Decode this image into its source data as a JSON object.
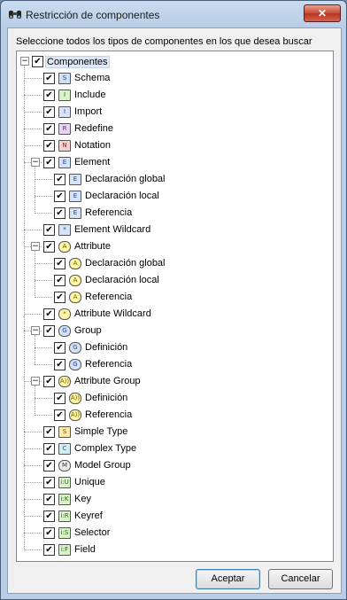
{
  "window": {
    "title": "Restricción de componentes",
    "close_glyph": "✕"
  },
  "prompt": "Seleccione todos los tipos de componentes en los que desea buscar",
  "tree": [
    {
      "label": "Componentes",
      "level": 0,
      "expander": "−",
      "icon": "",
      "icon_name": "",
      "bg": "",
      "fg": "",
      "selected": true
    },
    {
      "label": "Schema",
      "level": 1,
      "expander": "",
      "icon": "S",
      "icon_name": "schema-icon",
      "bg": "#cfe0f7",
      "fg": "#1f3f8f"
    },
    {
      "label": "Include",
      "level": 1,
      "expander": "",
      "icon": "I",
      "icon_name": "include-icon",
      "bg": "#d9f2c7",
      "fg": "#1f6a1f"
    },
    {
      "label": "Import",
      "level": 1,
      "expander": "",
      "icon": "I",
      "icon_name": "import-icon",
      "bg": "#d8e3f8",
      "fg": "#1f3f8f"
    },
    {
      "label": "Redefine",
      "level": 1,
      "expander": "",
      "icon": "R",
      "icon_name": "redefine-icon",
      "bg": "#e7d6f2",
      "fg": "#5c2b7a"
    },
    {
      "label": "Notation",
      "level": 1,
      "expander": "",
      "icon": "N",
      "icon_name": "notation-icon",
      "bg": "#f7d2d2",
      "fg": "#a01818"
    },
    {
      "label": "Element",
      "level": 1,
      "expander": "−",
      "icon": "E",
      "icon_name": "element-icon",
      "bg": "#d5e2f7",
      "fg": "#1f3f8f"
    },
    {
      "label": "Declaración global",
      "level": 2,
      "expander": "",
      "icon": "E",
      "icon_name": "element-global-icon",
      "bg": "#d5e2f7",
      "fg": "#1f3f8f"
    },
    {
      "label": "Declaración local",
      "level": 2,
      "expander": "",
      "icon": "E",
      "icon_name": "element-local-icon",
      "bg": "#d5e2f7",
      "fg": "#1f3f8f"
    },
    {
      "label": "Referencia",
      "level": 2,
      "expander": "",
      "icon": "E",
      "icon_name": "element-reference-icon",
      "bg": "#d5e2f7",
      "fg": "#1f3f8f"
    },
    {
      "label": "Element Wildcard",
      "level": 1,
      "expander": "",
      "icon": "*",
      "icon_name": "element-wildcard-icon",
      "bg": "#d5e2f7",
      "fg": "#1f3f8f"
    },
    {
      "label": "Attribute",
      "level": 1,
      "expander": "−",
      "icon": "A",
      "icon_name": "attribute-icon",
      "bg": "#fff6a6",
      "fg": "#6a5a00",
      "round": true
    },
    {
      "label": "Declaración global",
      "level": 2,
      "expander": "",
      "icon": "A",
      "icon_name": "attribute-global-icon",
      "bg": "#fff6a6",
      "fg": "#6a5a00",
      "round": true
    },
    {
      "label": "Declaración local",
      "level": 2,
      "expander": "",
      "icon": "A",
      "icon_name": "attribute-local-icon",
      "bg": "#fff6a6",
      "fg": "#6a5a00",
      "round": true
    },
    {
      "label": "Referencia",
      "level": 2,
      "expander": "",
      "icon": "A",
      "icon_name": "attribute-reference-icon",
      "bg": "#fff6a6",
      "fg": "#6a5a00",
      "round": true
    },
    {
      "label": "Attribute Wildcard",
      "level": 1,
      "expander": "",
      "icon": "*",
      "icon_name": "attribute-wildcard-icon",
      "bg": "#fff6a6",
      "fg": "#6a5a00",
      "round": true
    },
    {
      "label": "Group",
      "level": 1,
      "expander": "−",
      "icon": "G",
      "icon_name": "group-icon",
      "bg": "#d5e2f7",
      "fg": "#1f3f8f",
      "round": true
    },
    {
      "label": "Definición",
      "level": 2,
      "expander": "",
      "icon": "G",
      "icon_name": "group-definition-icon",
      "bg": "#d5e2f7",
      "fg": "#1f3f8f",
      "round": true
    },
    {
      "label": "Referencia",
      "level": 2,
      "expander": "",
      "icon": "G",
      "icon_name": "group-reference-icon",
      "bg": "#d5e2f7",
      "fg": "#1f3f8f",
      "round": true
    },
    {
      "label": "Attribute Group",
      "level": 1,
      "expander": "−",
      "icon": "A))",
      "icon_name": "attribute-group-icon",
      "bg": "#fff6a6",
      "fg": "#6a5a00",
      "round": true
    },
    {
      "label": "Definición",
      "level": 2,
      "expander": "",
      "icon": "A))",
      "icon_name": "attribute-group-definition-icon",
      "bg": "#fff6a6",
      "fg": "#6a5a00",
      "round": true
    },
    {
      "label": "Referencia",
      "level": 2,
      "expander": "",
      "icon": "A))",
      "icon_name": "attribute-group-reference-icon",
      "bg": "#fff6a6",
      "fg": "#6a5a00",
      "round": true
    },
    {
      "label": "Simple Type",
      "level": 1,
      "expander": "",
      "icon": "S",
      "icon_name": "simple-type-icon",
      "bg": "#fde9b0",
      "fg": "#7a4a00"
    },
    {
      "label": "Complex Type",
      "level": 1,
      "expander": "",
      "icon": "C",
      "icon_name": "complex-type-icon",
      "bg": "#cfeff7",
      "fg": "#1f5f7a"
    },
    {
      "label": "Model Group",
      "level": 1,
      "expander": "",
      "icon": "M",
      "icon_name": "model-group-icon",
      "bg": "#eeeeee",
      "fg": "#333333",
      "round": true
    },
    {
      "label": "Unique",
      "level": 1,
      "expander": "",
      "icon": "i:U",
      "icon_name": "unique-icon",
      "bg": "#d9f2c7",
      "fg": "#1f6a1f"
    },
    {
      "label": "Key",
      "level": 1,
      "expander": "",
      "icon": "i:K",
      "icon_name": "key-icon",
      "bg": "#d9f2c7",
      "fg": "#1f6a1f"
    },
    {
      "label": "Keyref",
      "level": 1,
      "expander": "",
      "icon": "i:R",
      "icon_name": "keyref-icon",
      "bg": "#d9f2c7",
      "fg": "#1f6a1f"
    },
    {
      "label": "Selector",
      "level": 1,
      "expander": "",
      "icon": "i:S",
      "icon_name": "selector-icon",
      "bg": "#d9f2c7",
      "fg": "#1f6a1f"
    },
    {
      "label": "Field",
      "level": 1,
      "expander": "",
      "icon": "i:F",
      "icon_name": "field-icon",
      "bg": "#d9f2c7",
      "fg": "#1f6a1f"
    }
  ],
  "checkmark": "✔",
  "buttons": {
    "ok": "Aceptar",
    "cancel": "Cancelar"
  }
}
